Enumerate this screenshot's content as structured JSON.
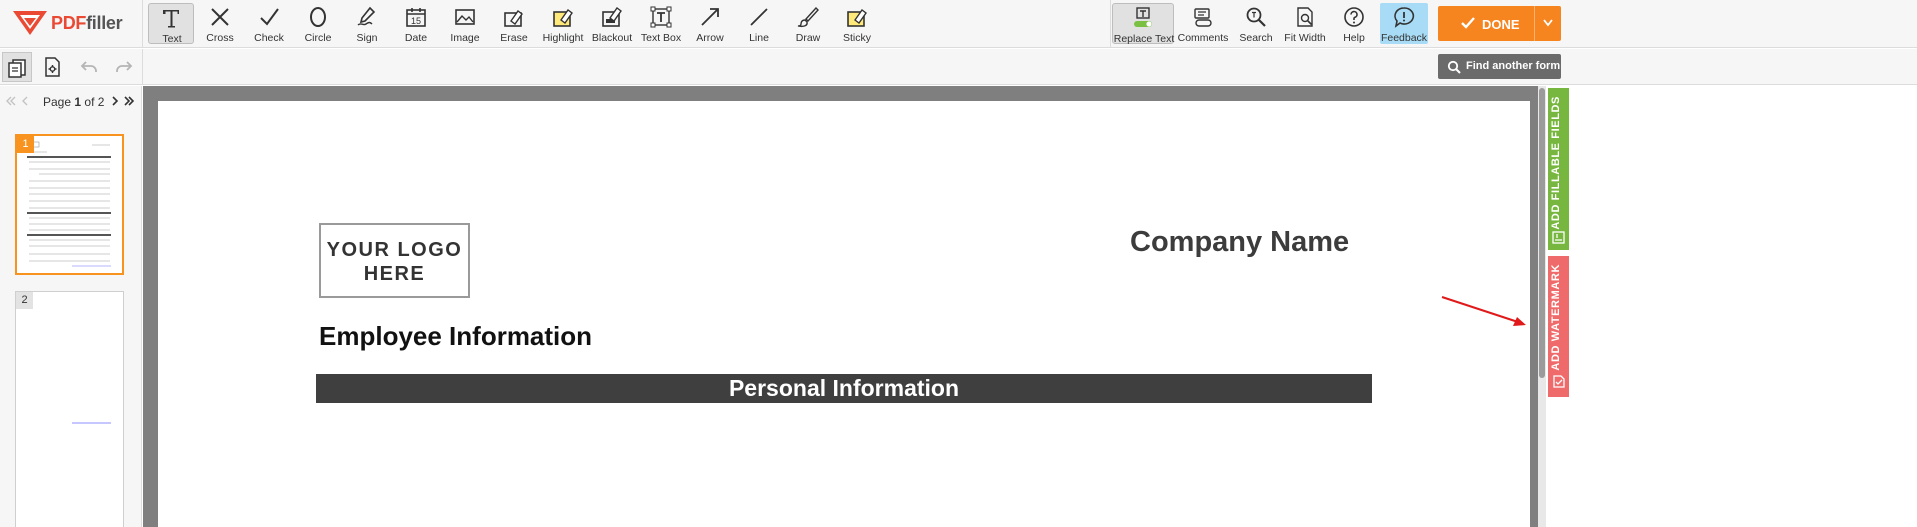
{
  "app": {
    "brand_pdf": "PDF",
    "brand_filler": "filler",
    "brand_color": "#ea4a34"
  },
  "toolbar": {
    "tools": [
      {
        "id": "text",
        "label": "Text",
        "icon": "text-T-icon"
      },
      {
        "id": "cross",
        "label": "Cross",
        "icon": "cross-icon"
      },
      {
        "id": "check",
        "label": "Check",
        "icon": "check-icon"
      },
      {
        "id": "circle",
        "label": "Circle",
        "icon": "circle-icon"
      },
      {
        "id": "sign",
        "label": "Sign",
        "icon": "pen-sign-icon"
      },
      {
        "id": "date",
        "label": "Date",
        "icon": "calendar-icon"
      },
      {
        "id": "image",
        "label": "Image",
        "icon": "image-icon"
      },
      {
        "id": "erase",
        "label": "Erase",
        "icon": "eraser-icon"
      },
      {
        "id": "highlight",
        "label": "Highlight",
        "icon": "highlighter-icon"
      },
      {
        "id": "blackout",
        "label": "Blackout",
        "icon": "blackout-icon"
      },
      {
        "id": "textbox",
        "label": "Text Box",
        "icon": "textbox-icon"
      },
      {
        "id": "arrow",
        "label": "Arrow",
        "icon": "arrow-icon"
      },
      {
        "id": "line",
        "label": "Line",
        "icon": "line-icon"
      },
      {
        "id": "draw",
        "label": "Draw",
        "icon": "brush-icon"
      },
      {
        "id": "sticky",
        "label": "Sticky",
        "icon": "sticky-note-icon"
      }
    ],
    "date_icon_number": "15",
    "right_tools": [
      {
        "id": "replace",
        "label": "Replace Text",
        "icon": "replace-text-icon"
      },
      {
        "id": "comments",
        "label": "Comments",
        "icon": "comments-icon"
      },
      {
        "id": "search",
        "label": "Search",
        "icon": "search-icon"
      },
      {
        "id": "fitwidth",
        "label": "Fit Width",
        "icon": "fit-width-icon"
      },
      {
        "id": "help",
        "label": "Help",
        "icon": "help-icon"
      },
      {
        "id": "feedback",
        "label": "Feedback",
        "icon": "feedback-icon"
      }
    ],
    "done_label": "DONE",
    "done_color": "#f7851f",
    "feedback_color": "#a8dcf6"
  },
  "subbar": {
    "find_label": "Find another form"
  },
  "pager": {
    "prefix": "Page",
    "current": "1",
    "of_label": "of",
    "total": "2"
  },
  "thumbnails": [
    {
      "num": "1",
      "selected": true
    },
    {
      "num": "2",
      "selected": false
    }
  ],
  "document": {
    "logo_line1": "YOUR LOGO",
    "logo_line2": "HERE",
    "company": "Company Name",
    "heading": "Employee Information",
    "section_bar": "Personal Information"
  },
  "side_tabs": {
    "fillable": "ADD FILLABLE FIELDS",
    "fillable_color": "#77b740",
    "watermark": "ADD WATERMARK",
    "watermark_color": "#ef6b6b"
  }
}
